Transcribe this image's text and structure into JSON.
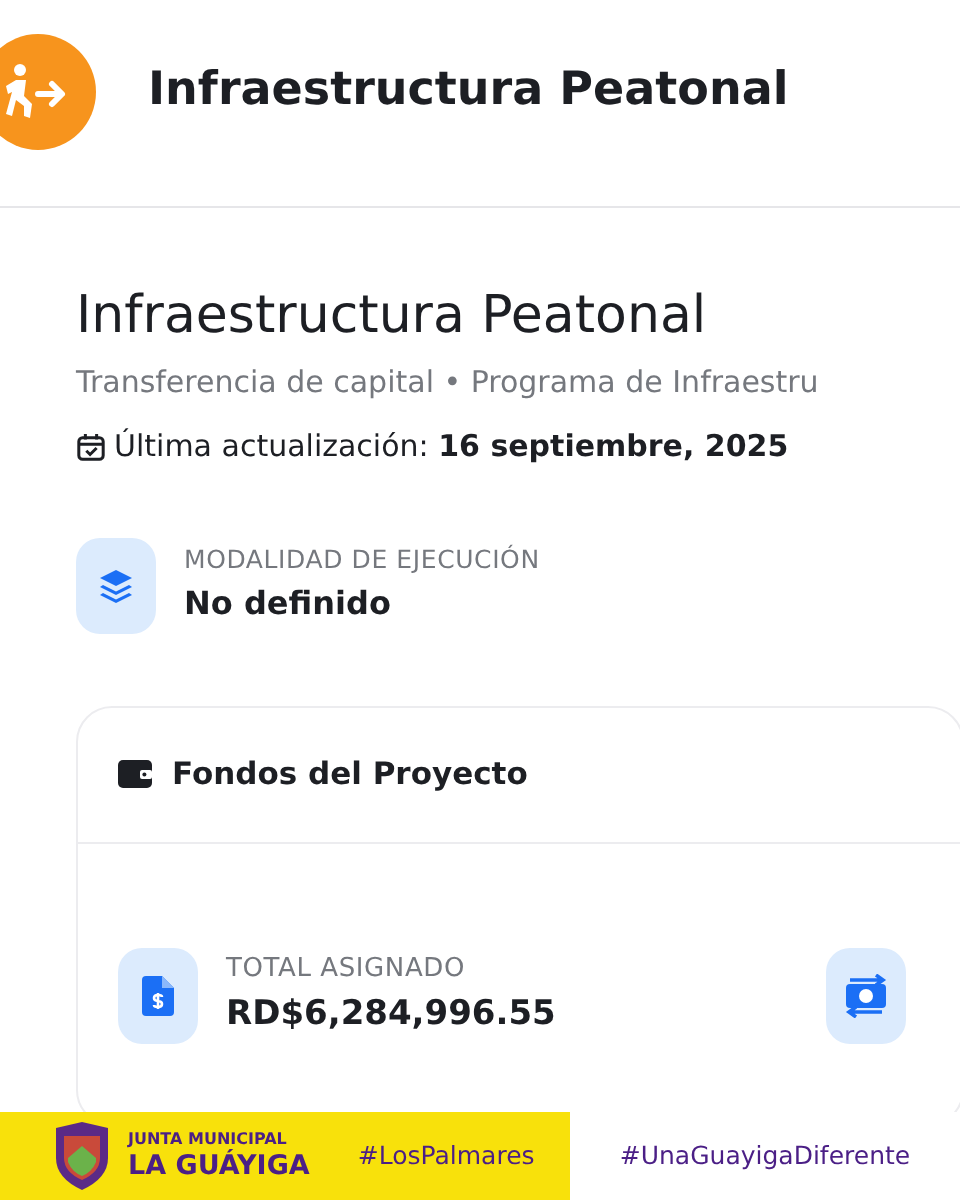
{
  "header": {
    "title": "Infraestructura Peatonal"
  },
  "project": {
    "title": "Infraestructura Peatonal",
    "subtitle": "Transferencia de capital • Programa de Infraestru",
    "updated": "Última actualización: **16 septiembre, 2025**"
  },
  "modality": {
    "label": "MODALIDAD DE EJECUCIÓN",
    "value": "No definido"
  },
  "funds_card": {
    "title": "Fondos del Proyecto",
    "items": [
      {
        "kind": "document",
        "label": "TOTAL ASIGNADO",
        "value": "RD$6,284,996.55"
      },
      {
        "kind": "exchange"
      }
    ]
  },
  "banner": {
    "org_top": "JUNTA MUNICIPAL",
    "org_name": "LA GUÁYIGA",
    "tag_left": "#LosPalmares",
    "tag_right": "#UnaGuayigaDiferente"
  }
}
